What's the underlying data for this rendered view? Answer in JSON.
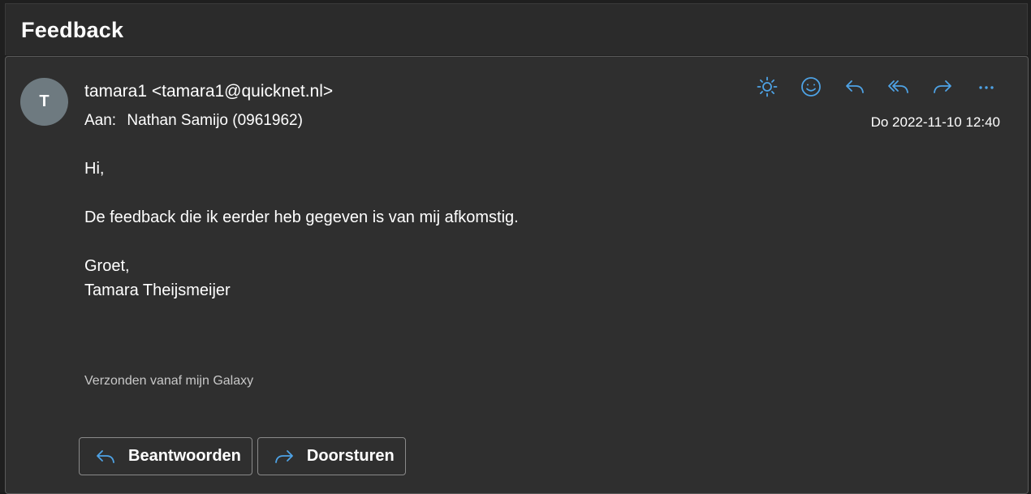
{
  "subject": "Feedback",
  "sender": {
    "initial": "T",
    "from": "tamara1 <tamara1@quicknet.nl>"
  },
  "recipient": {
    "label": "Aan:",
    "name": "Nathan Samijo (0961962)"
  },
  "date": "Do 2022-11-10 12:40",
  "body": {
    "greeting": "Hi,",
    "paragraph": "De feedback die ik eerder heb gegeven is van mij afkomstig.",
    "closing": "Groet,",
    "name": "Tamara Theijsmeijer"
  },
  "signature": "Verzonden vanaf mijn Galaxy",
  "toolbar": {
    "icons": [
      "sun-icon",
      "emoji-icon",
      "reply-icon",
      "reply-all-icon",
      "forward-icon",
      "more-icon"
    ]
  },
  "actions": {
    "reply_label": "Beantwoorden",
    "forward_label": "Doorsturen"
  },
  "colors": {
    "accent": "#4ea3e6",
    "background": "#2f2f2f"
  }
}
